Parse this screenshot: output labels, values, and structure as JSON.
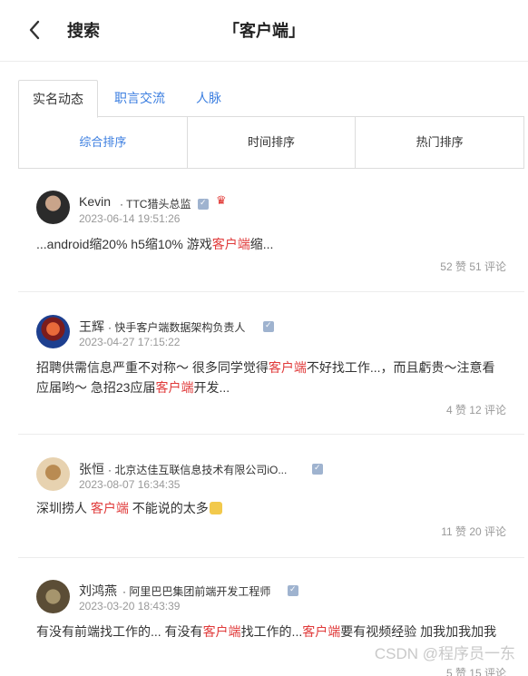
{
  "header": {
    "back_icon": "chevron-left-icon",
    "title": "搜索",
    "keyword": "「客户端」"
  },
  "tabs": [
    {
      "label": "实名动态",
      "active": true
    },
    {
      "label": "职言交流",
      "active": false
    },
    {
      "label": "人脉",
      "active": false
    }
  ],
  "sort_options": [
    {
      "label": "综合排序",
      "active": true
    },
    {
      "label": "时间排序",
      "active": false
    },
    {
      "label": "热门排序",
      "active": false
    }
  ],
  "posts": [
    {
      "name": "Kevin",
      "title": "· TTC猎头总监",
      "time": "2023-06-14 19:51:26",
      "content": [
        {
          "text": "...android缩20% h5缩10% 游戏"
        },
        {
          "text": "客户端",
          "hl": true
        },
        {
          "text": "缩..."
        }
      ],
      "stats": "52 赞 51 评论"
    },
    {
      "name": "王辉",
      "title": "· 快手客户端数据架构负责人",
      "time": "2023-04-27 17:15:22",
      "content": [
        {
          "text": "招聘供需信息严重不对称～ 很多同学觉得"
        },
        {
          "text": "客户端",
          "hl": true
        },
        {
          "text": "不好找工作...，而且虧贵～注意看应届哟～ 急招23应届"
        },
        {
          "text": "客户端",
          "hl": true
        },
        {
          "text": "开发..."
        }
      ],
      "stats": "4 赞 12 评论"
    },
    {
      "name": "张恒",
      "title": "· 北京达佳互联信息技术有限公司iO...",
      "time": "2023-08-07 16:34:35",
      "content": [
        {
          "text": "深圳捞人 "
        },
        {
          "text": "客户端",
          "hl": true
        },
        {
          "text": " 不能说的太多"
        }
      ],
      "stats": "11 赞 20 评论"
    },
    {
      "name": "刘鸿燕",
      "title": "· 阿里巴巴集团前端开发工程师",
      "time": "2023-03-20 18:43:39",
      "content": [
        {
          "text": "有没有前端找工作的... 有没有"
        },
        {
          "text": "客户端",
          "hl": true
        },
        {
          "text": "找工作的..."
        },
        {
          "text": "客户端",
          "hl": true
        },
        {
          "text": "要有视频经验 加我加我加我"
        }
      ],
      "stats": "5 赞 15 评论"
    }
  ],
  "watermark": "CSDN @程序员一东",
  "colors": {
    "accent": "#3b7ee0",
    "highlight": "#e03a3a",
    "muted": "#999999"
  }
}
